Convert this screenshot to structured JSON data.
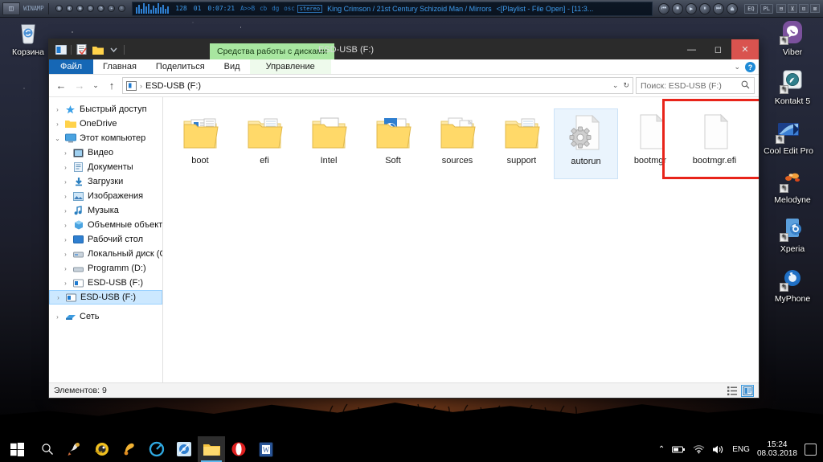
{
  "player": {
    "app_name": "WINAMP",
    "bitrate": "128",
    "khz": "01",
    "time": "0:07:21",
    "channels": "A>>B",
    "cb": "cb",
    "dg": "dg",
    "osc": "osc",
    "mode": "stereo",
    "track_title": "King Crimson / 21st Century Schizoid Man / Mirrors",
    "playlist_status": "<[Playlist - File Open] - [11:3...",
    "buttons": {
      "previous": "prev-track",
      "stop": "stop",
      "play": "play",
      "pause": "pause",
      "next": "next-track",
      "eject": "eject"
    },
    "tags": {
      "equalizer": "EQ",
      "playlist": "PL"
    },
    "window_buttons": [
      "minimize",
      "shade",
      "restore",
      "close"
    ]
  },
  "desktop": {
    "recycle_bin": {
      "label": "Корзина"
    },
    "icons": [
      {
        "label": "Viber",
        "icon": "viber-icon",
        "color": "#7b519d"
      },
      {
        "label": "Kontakt 5",
        "icon": "kontakt-icon",
        "color": "#2f7f8c"
      },
      {
        "label": "Cool Edit Pro",
        "icon": "cooledit-icon",
        "color": "#2b5bb5"
      },
      {
        "label": "Melodyne",
        "icon": "melodyne-icon",
        "color": "#e0601f"
      },
      {
        "label": "Xperia",
        "icon": "xperia-icon",
        "color": "#2f7ac4"
      },
      {
        "label": "MyPhone",
        "icon": "myphone-icon",
        "color": "#1f6fc4"
      }
    ]
  },
  "explorer": {
    "window_title": "ESD-USB (F:)",
    "contextual_tab": "Средства работы с дисками",
    "quick_access": [
      {
        "name": "drive-icon"
      },
      {
        "name": "properties-icon"
      },
      {
        "name": "new-folder-icon"
      },
      {
        "name": "customize-dropdown-icon"
      }
    ],
    "caption": {
      "minimize": "—",
      "maximize": "◻",
      "close": "✕"
    },
    "tabs": [
      {
        "label": "Файл",
        "type": "file"
      },
      {
        "label": "Главная",
        "type": "normal"
      },
      {
        "label": "Поделиться",
        "type": "normal"
      },
      {
        "label": "Вид",
        "type": "normal"
      },
      {
        "label": "Управление",
        "type": "contextual"
      }
    ],
    "ribbon_right": {
      "collapse": "⌄",
      "help": "?"
    },
    "address": {
      "back": "←",
      "forward": "→",
      "recent": "⌄",
      "up": "↑",
      "drive_label": "ESD-USB (F:)",
      "separator": "›",
      "dropdown": "⌄",
      "refresh": "↻"
    },
    "search": {
      "placeholder": "Поиск: ESD-USB (F:)",
      "icon": "search-icon"
    },
    "nav_tree": [
      {
        "label": "Быстрый доступ",
        "icon": "star-icon",
        "expander": "›",
        "indent": false,
        "selected": false
      },
      {
        "label": "OneDrive",
        "icon": "onedrive-icon",
        "expander": "›",
        "indent": false,
        "selected": false
      },
      {
        "label": "Этот компьютер",
        "icon": "computer-icon",
        "expander": "⌄",
        "indent": false,
        "selected": false
      },
      {
        "label": "Видео",
        "icon": "video-icon",
        "expander": "›",
        "indent": true,
        "selected": false
      },
      {
        "label": "Документы",
        "icon": "documents-icon",
        "expander": "›",
        "indent": true,
        "selected": false
      },
      {
        "label": "Загрузки",
        "icon": "downloads-icon",
        "expander": "›",
        "indent": true,
        "selected": false
      },
      {
        "label": "Изображения",
        "icon": "pictures-icon",
        "expander": "›",
        "indent": true,
        "selected": false
      },
      {
        "label": "Музыка",
        "icon": "music-icon",
        "expander": "›",
        "indent": true,
        "selected": false
      },
      {
        "label": "Объемные объекты",
        "icon": "3d-objects-icon",
        "expander": "›",
        "indent": true,
        "selected": false
      },
      {
        "label": "Рабочий стол",
        "icon": "desktop-icon",
        "expander": "›",
        "indent": true,
        "selected": false
      },
      {
        "label": "Локальный диск (C:)",
        "icon": "harddisk-icon",
        "expander": "›",
        "indent": true,
        "selected": false
      },
      {
        "label": "Programm (D:)",
        "icon": "harddisk-icon",
        "expander": "›",
        "indent": true,
        "selected": false
      },
      {
        "label": "ESD-USB (F:)",
        "icon": "usb-drive-icon",
        "expander": "›",
        "indent": true,
        "selected": false
      },
      {
        "label": "ESD-USB (F:)",
        "icon": "usb-drive-icon",
        "expander": "›",
        "indent": false,
        "selected": true
      },
      {
        "label": "Сеть",
        "icon": "network-icon",
        "expander": "›",
        "indent": false,
        "selected": false
      }
    ],
    "items": [
      {
        "name": "boot",
        "type": "folder-document",
        "selected": false
      },
      {
        "name": "efi",
        "type": "folder-list",
        "selected": false
      },
      {
        "name": "Intel",
        "type": "folder-blank",
        "selected": false
      },
      {
        "name": "Soft",
        "type": "folder-sync",
        "selected": false
      },
      {
        "name": "sources",
        "type": "folder-pages",
        "selected": false
      },
      {
        "name": "support",
        "type": "folder-list",
        "selected": false
      },
      {
        "name": "autorun",
        "type": "file-gear",
        "selected": true
      },
      {
        "name": "bootmgr",
        "type": "file-blank",
        "selected": false
      },
      {
        "name": "bootmgr.efi",
        "type": "file-blank",
        "selected": false
      }
    ],
    "highlight_color": "#e8241a",
    "status": {
      "count_label": "Элементов: 9"
    },
    "view_buttons": [
      {
        "name": "details-view",
        "active": false
      },
      {
        "name": "large-icons-view",
        "active": true
      }
    ]
  },
  "taskbar": {
    "start": "start-button",
    "search": "search-icon",
    "items": [
      {
        "name": "paint-net-icon",
        "active": false
      },
      {
        "name": "audacity-icon",
        "active": false
      },
      {
        "name": "fl-studio-icon",
        "active": false
      },
      {
        "name": "cubase-icon",
        "active": false
      },
      {
        "name": "winamp-icon",
        "active": false
      },
      {
        "name": "file-explorer-icon",
        "active": true
      },
      {
        "name": "opera-icon",
        "active": false
      },
      {
        "name": "word-icon",
        "active": false
      }
    ],
    "tray": {
      "show_hidden": "⌃",
      "battery": "battery-icon",
      "network": "wifi-icon",
      "volume": "volume-icon",
      "language": "ENG",
      "time": "15:24",
      "date": "08.03.2018",
      "action_center": "notifications-icon"
    }
  }
}
